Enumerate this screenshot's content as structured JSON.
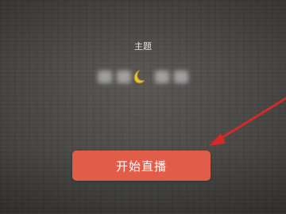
{
  "topic": {
    "label": "主题"
  },
  "actions": {
    "start_live_label": "开始直播"
  },
  "annotation": {
    "arrow_color": "#d42a2a"
  },
  "colors": {
    "button_bg": "#e25c4a",
    "background": "#4a4845"
  },
  "icons": {
    "topic_icon": "crescent-moon-icon"
  }
}
